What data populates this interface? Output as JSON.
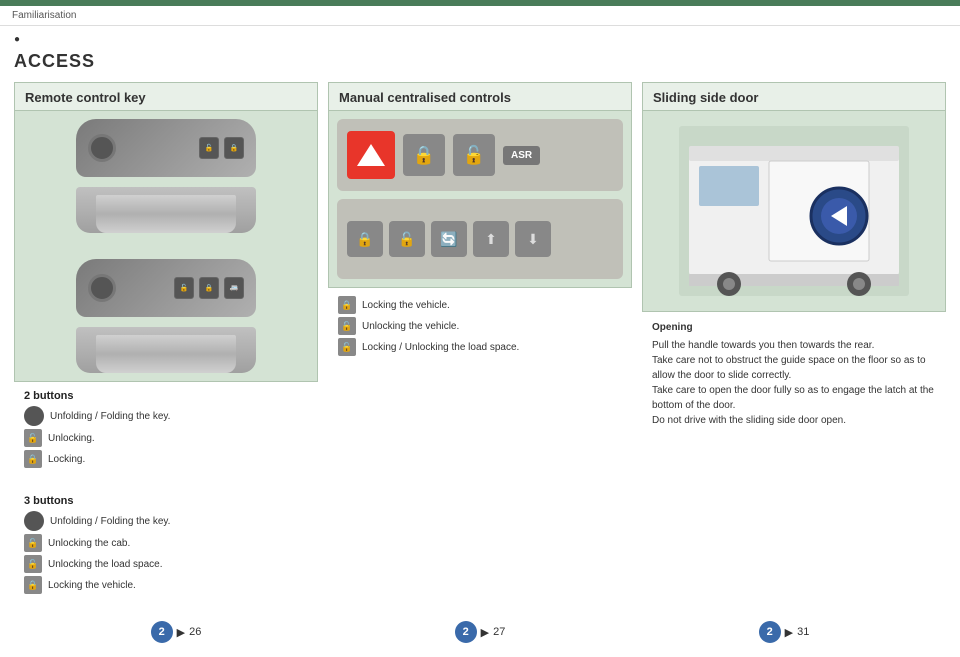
{
  "breadcrumb": {
    "text": "Familiarisation"
  },
  "page_marker": "●",
  "section": {
    "title": "ACCESS"
  },
  "panel1": {
    "title": "Remote control key",
    "desc_heading_2btn": "2 buttons",
    "items_2btn": [
      {
        "icon": "circle",
        "text": "Unfolding / Folding the key."
      },
      {
        "icon": "lock-open",
        "text": "Unlocking."
      },
      {
        "icon": "lock-closed",
        "text": "Locking."
      }
    ],
    "desc_heading_3btn": "3 buttons",
    "items_3btn": [
      {
        "icon": "circle",
        "text": "Unfolding / Folding the key."
      },
      {
        "icon": "lock-open",
        "text": "Unlocking the cab."
      },
      {
        "icon": "lock-open-load",
        "text": "Unlocking the load space."
      },
      {
        "icon": "lock-closed",
        "text": "Locking the vehicle."
      }
    ],
    "ref": {
      "circle": "2",
      "arrow": "▶",
      "num": "26"
    }
  },
  "panel2": {
    "title": "Manual centralised controls",
    "items": [
      {
        "icon": "lock-closed",
        "text": "Locking the vehicle."
      },
      {
        "icon": "lock-open",
        "text": "Unlocking the vehicle."
      },
      {
        "icon": "lock-load",
        "text": "Locking / Unlocking the load space."
      }
    ],
    "ref": {
      "circle": "2",
      "arrow": "▶",
      "num": "27"
    }
  },
  "panel3": {
    "title": "Sliding side door",
    "desc_title": "Opening",
    "desc_lines": [
      "Pull the handle towards you then towards the rear.",
      "Take care not to obstruct the guide space on the floor so as to allow the door to slide correctly.",
      "Take care to open the door fully so as to engage the latch at the bottom of the door.",
      "Do not drive with the sliding side door open."
    ],
    "ref": {
      "circle": "2",
      "arrow": "▶",
      "num": "31"
    }
  }
}
